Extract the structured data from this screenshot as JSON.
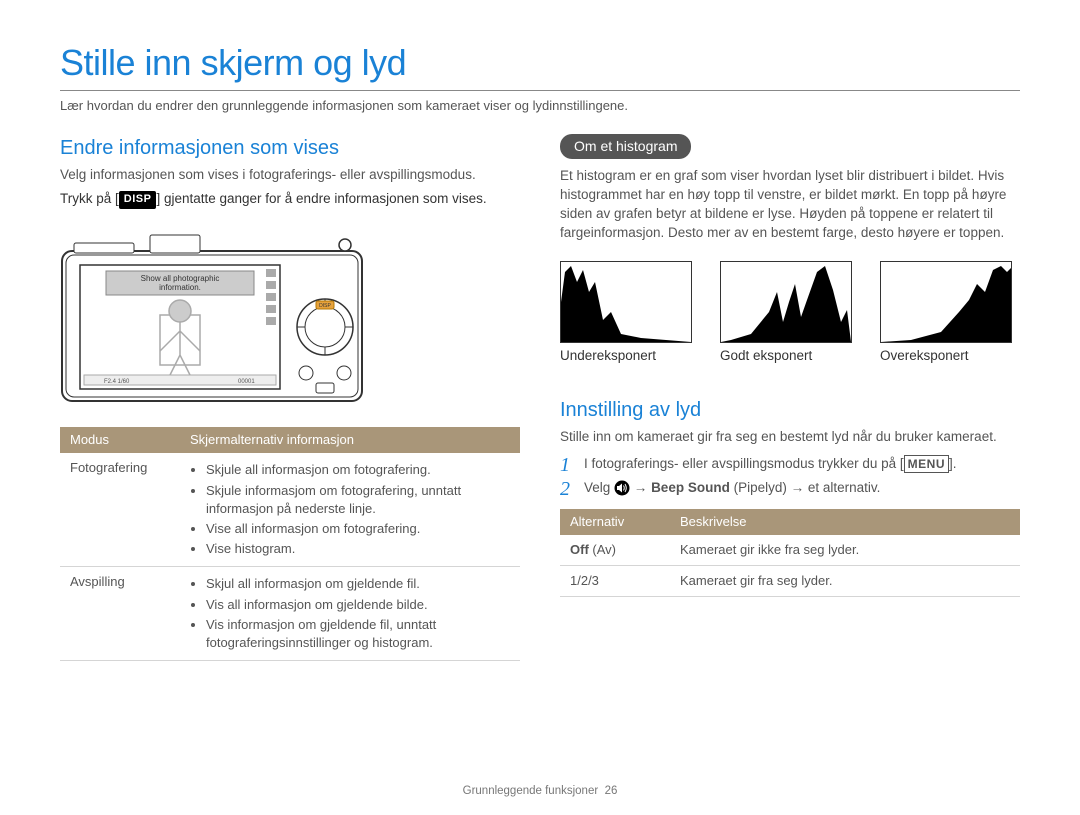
{
  "title": "Stille inn skjerm og lyd",
  "subtitle": "Lær hvordan du endrer den grunnleggende informasjonen som kameraet viser og lydinnstillingene.",
  "left": {
    "heading": "Endre informasjonen som vises",
    "intro": "Velg informasjonen som vises i fotograferings- eller avspillingsmodus.",
    "pressText_a": "Trykk på [",
    "pressText_b": "] gjentatte ganger for å endre informasjonen som vises.",
    "disp": "DISP",
    "camera_overlay_1": "Show all photographic",
    "camera_overlay_2": "information.",
    "table": {
      "head_mode": "Modus",
      "head_info": "Skjermalternativ informasjon",
      "rows": [
        {
          "mode": "Fotografering",
          "items": [
            "Skjule all informasjon om fotografering.",
            "Skjule informasjom om fotografering, unntatt informasjon på nederste linje.",
            "Vise all informasjon om fotografering.",
            "Vise histogram."
          ]
        },
        {
          "mode": "Avspilling",
          "items": [
            "Skjul all informasjon om gjeldende fil.",
            "Vis all informasjon om gjeldende bilde.",
            "Vis informasjon om gjeldende fil, unntatt fotograferingsinnstillinger og histogram."
          ]
        }
      ]
    }
  },
  "right": {
    "pill": "Om et histogram",
    "histo_text": "Et histogram er en graf som viser hvordan lyset blir distribuert i bildet. Hvis histogrammet har en høy topp til venstre, er bildet mørkt. En topp på høyre siden av grafen betyr at bildene er lyse. Høyden på toppene er relatert til fargeinformasjon. Desto mer av en bestemt farge, desto høyere er toppen.",
    "histo_labels": [
      "Undereksponert",
      "Godt eksponert",
      "Overeksponert"
    ],
    "sound_heading": "Innstilling av lyd",
    "sound_intro": "Stille inn om kameraet gir fra seg en bestemt lyd når du bruker kameraet.",
    "step1_a": "I fotograferings- eller avspillingsmodus trykker du på [",
    "step1_b": "].",
    "menu": "MENU",
    "step2_a": "Velg ",
    "step2_b": " → ",
    "step2_c": "Beep Sound",
    "step2_d": " (Pipelyd) → et alternativ.",
    "table": {
      "head_alt": "Alternativ",
      "head_desc": "Beskrivelse",
      "rows": [
        {
          "alt": "Off",
          "alt_paren": " (Av)",
          "desc": "Kameraet gir ikke fra seg lyder."
        },
        {
          "alt": "1/2/3",
          "alt_paren": "",
          "desc": "Kameraet gir fra seg lyder."
        }
      ]
    }
  },
  "footer_a": "Grunnleggende funksjoner",
  "footer_b": "26"
}
